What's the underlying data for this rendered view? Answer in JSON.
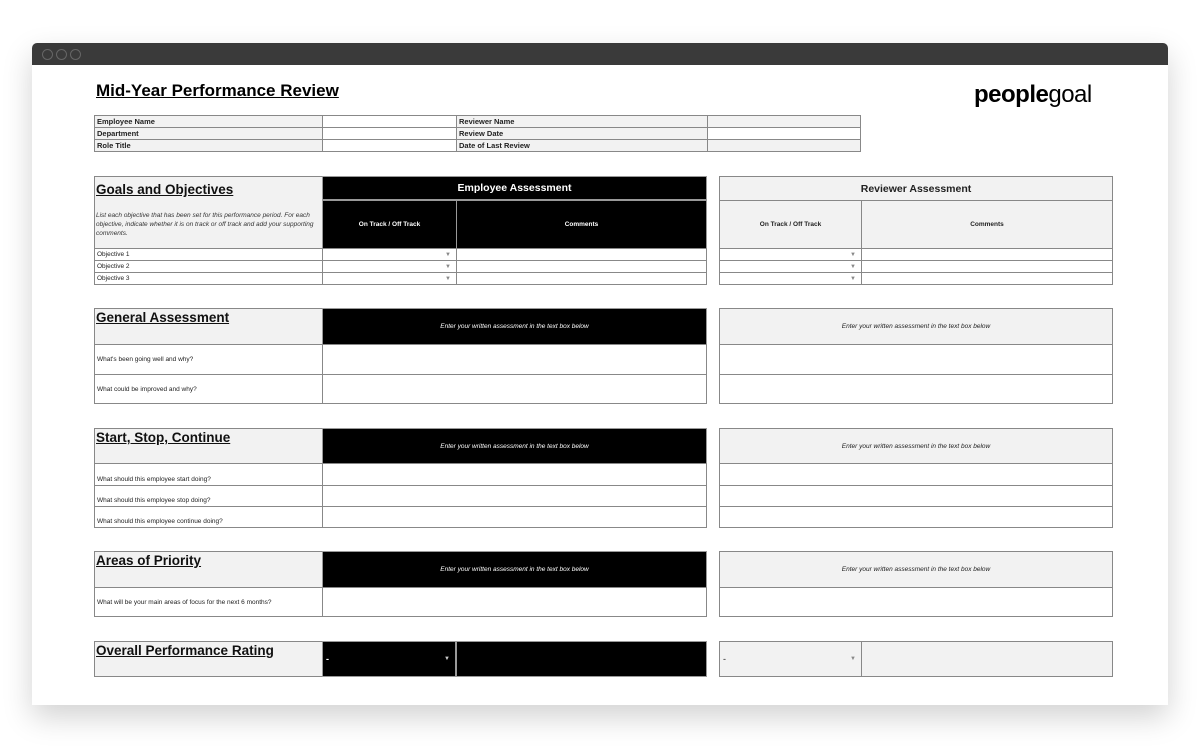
{
  "title": "Mid-Year Performance Review",
  "logo": {
    "bold": "people",
    "light": "goal"
  },
  "info": {
    "employee_name": "Employee Name",
    "department": "Department",
    "role_title": "Role Title",
    "reviewer_name": "Reviewer Name",
    "review_date": "Review Date",
    "date_last_review": "Date of Last Review"
  },
  "employee_assessment": "Employee Assessment",
  "reviewer_assessment": "Reviewer Assessment",
  "goals": {
    "title": "Goals and Objectives",
    "description": "List each objective that has been set for this performance period. For each objective, indicate whether it is on track or off track and add your supporting comments.",
    "col_status": "On Track / Off Track",
    "col_comments": "Comments",
    "objectives": [
      "Objective 1",
      "Objective 2",
      "Objective 3"
    ]
  },
  "prompt": "Enter your written assessment in the text box below",
  "general": {
    "title": "General Assessment",
    "questions": [
      "What's been going well and why?",
      "What could be improved and why?"
    ]
  },
  "ssc": {
    "title": "Start, Stop, Continue",
    "questions": [
      "What should this employee start doing?",
      "What should this employee stop doing?",
      "What should this employee continue doing?"
    ]
  },
  "priority": {
    "title": "Areas of Priority",
    "questions": [
      "What will be your main areas of focus for the next 6 months?"
    ]
  },
  "overall": {
    "title": "Overall Performance Rating",
    "employee_value": "-",
    "reviewer_value": "-"
  }
}
